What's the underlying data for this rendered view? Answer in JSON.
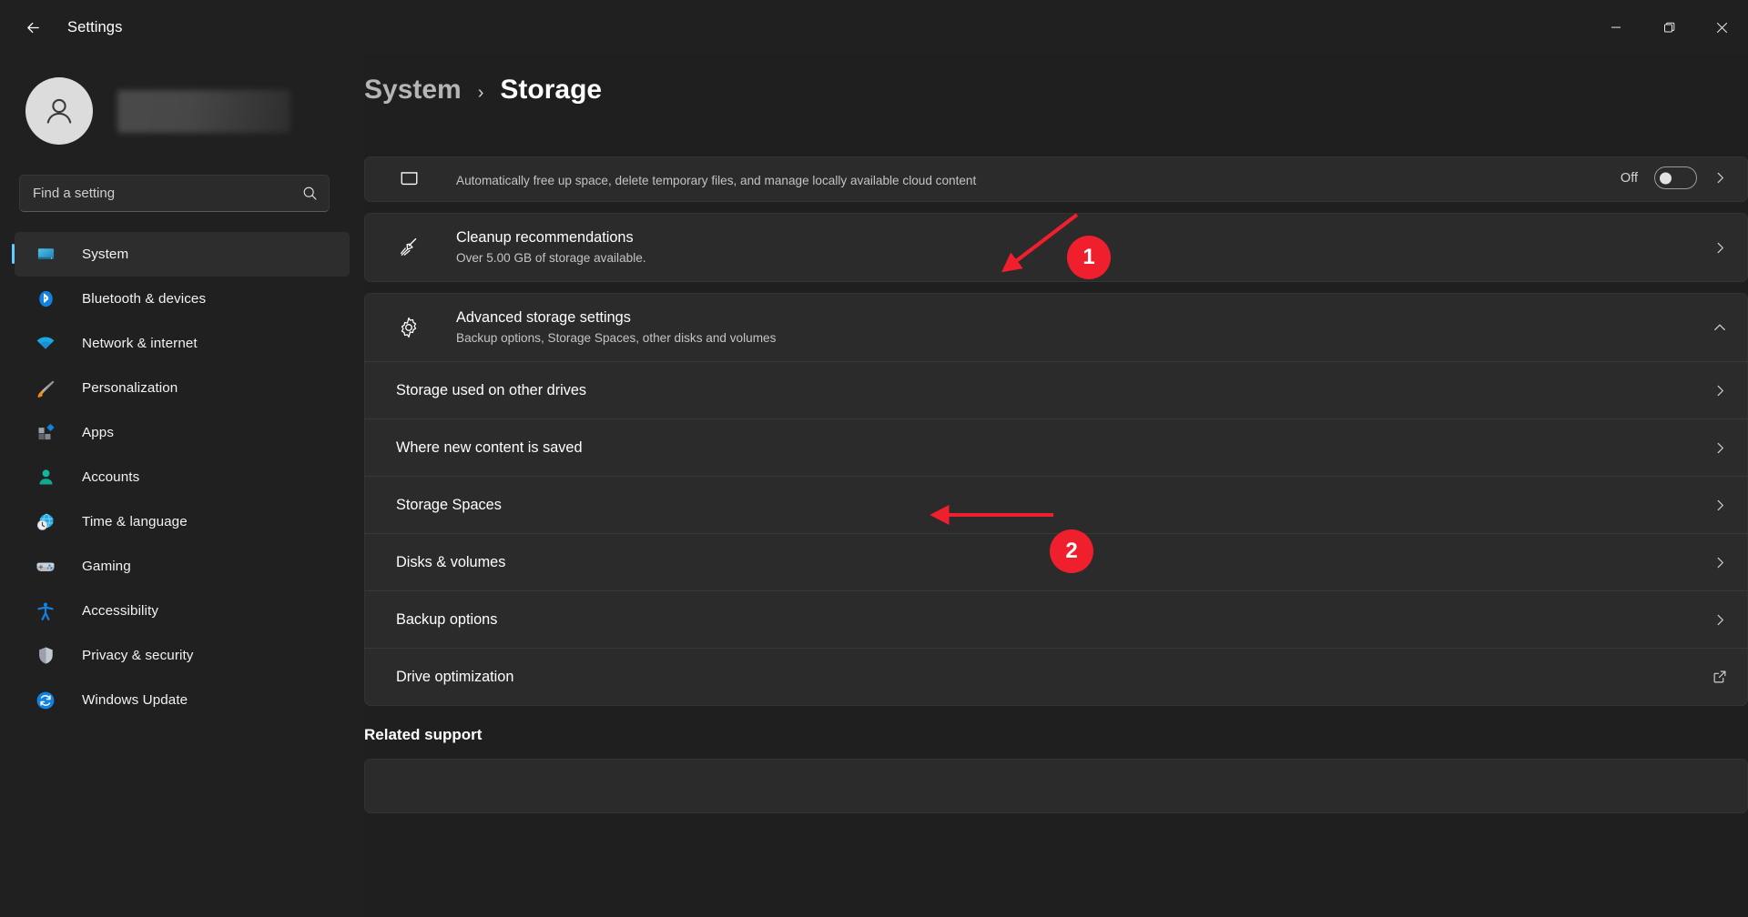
{
  "window": {
    "app_title": "Settings",
    "back_icon": "back-arrow-icon",
    "minimize_label": "─",
    "maximize_label": "❐",
    "close_label": "✕"
  },
  "sidebar": {
    "account": {
      "avatar_icon": "person-avatar-icon",
      "name_redacted": ""
    },
    "search": {
      "placeholder": "Find a setting",
      "value": "",
      "icon": "search-icon"
    },
    "items": [
      {
        "label": "System",
        "icon": "system-monitor-icon",
        "active": true
      },
      {
        "label": "Bluetooth & devices",
        "icon": "bluetooth-icon",
        "active": false
      },
      {
        "label": "Network & internet",
        "icon": "wifi-icon",
        "active": false
      },
      {
        "label": "Personalization",
        "icon": "paintbrush-icon",
        "active": false
      },
      {
        "label": "Apps",
        "icon": "apps-squares-icon",
        "active": false
      },
      {
        "label": "Accounts",
        "icon": "person-icon",
        "active": false
      },
      {
        "label": "Time & language",
        "icon": "globe-clock-icon",
        "active": false
      },
      {
        "label": "Gaming",
        "icon": "gamepad-icon",
        "active": false
      },
      {
        "label": "Accessibility",
        "icon": "accessibility-icon",
        "active": false
      },
      {
        "label": "Privacy & security",
        "icon": "shield-icon",
        "active": false
      },
      {
        "label": "Windows Update",
        "icon": "refresh-circle-icon",
        "active": false
      }
    ]
  },
  "header": {
    "breadcrumb_parent": "System",
    "breadcrumb_separator": "›",
    "breadcrumb_current": "Storage"
  },
  "main": {
    "storage_sense": {
      "subtitle": "Automatically free up space, delete temporary files, and manage locally available cloud content",
      "toggle_label": "Off",
      "toggle_state": "off"
    },
    "cleanup": {
      "title": "Cleanup recommendations",
      "subtitle": "Over 5.00 GB of storage available.",
      "icon": "broom-icon",
      "chevron": "chevron-right-icon"
    },
    "advanced": {
      "title": "Advanced storage settings",
      "subtitle": "Backup options, Storage Spaces, other disks and volumes",
      "icon": "gear-icon",
      "chevron": "chevron-up-icon",
      "expanded": true,
      "sub_items": [
        {
          "label": "Storage used on other drives",
          "trailing": "chevron-right-icon"
        },
        {
          "label": "Where new content is saved",
          "trailing": "chevron-right-icon"
        },
        {
          "label": "Storage Spaces",
          "trailing": "chevron-right-icon"
        },
        {
          "label": "Disks & volumes",
          "trailing": "chevron-right-icon"
        },
        {
          "label": "Backup options",
          "trailing": "chevron-right-icon"
        },
        {
          "label": "Drive optimization",
          "trailing": "external-link-icon"
        }
      ]
    },
    "related_support_title": "Related support"
  },
  "annotations": {
    "accent_color": "#f01f2e",
    "markers": [
      {
        "number": "1",
        "points_to": "Advanced storage settings"
      },
      {
        "number": "2",
        "points_to": "Disks & volumes"
      }
    ]
  }
}
